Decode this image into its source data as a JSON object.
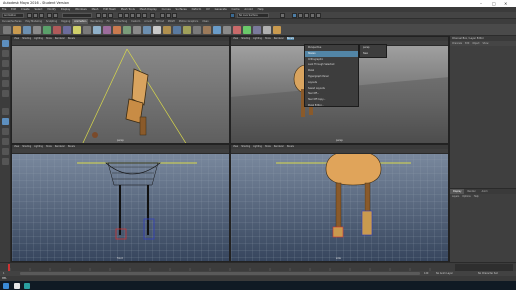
{
  "window": {
    "title": "Autodesk Maya 2016 - Student Version",
    "minimize": "–",
    "maximize": "□",
    "close": "✕"
  },
  "menubar": [
    "File",
    "Edit",
    "Create",
    "Select",
    "Modify",
    "Display",
    "Windows",
    "Mesh",
    "Edit Mesh",
    "Mesh Tools",
    "Mesh Display",
    "Curves",
    "Surfaces",
    "Deform",
    "UV",
    "Generate",
    "Cache",
    "Arnold",
    "Help"
  ],
  "statusline": {
    "menuset": "Animation",
    "no_live": "No Live Surface"
  },
  "shelf_tabs": [
    "Curves/Surfaces",
    "Poly Modeling",
    "Sculpting",
    "Rigging",
    "Animation",
    "Rendering",
    "FX",
    "FX Caching",
    "Custom",
    "Arnold",
    "Bifrost",
    "MASH",
    "Motion Graphics",
    "XGen"
  ],
  "shelf_active": "Animation",
  "viewports": {
    "panel_menu": [
      "View",
      "Shading",
      "Lighting",
      "Show",
      "Renderer",
      "Panels"
    ],
    "top_left": "persp",
    "top_right": "persp",
    "bottom_left": "front",
    "bottom_right": "side"
  },
  "panels_dropdown": {
    "items": [
      "Perspective",
      "Stereo",
      "Orthographic",
      "Look Through Selected",
      "Panel",
      "Hypergraph Panel",
      "Layouts",
      "Saved Layouts",
      "Tear Off...",
      "Tear Off Copy...",
      "Panel Editor..."
    ],
    "highlighted": "Stereo",
    "submenu": [
      "persp",
      "New"
    ]
  },
  "channel_box": {
    "header": "Channel Box / Layer Editor",
    "menus": [
      "Channels",
      "Edit",
      "Object",
      "Show"
    ]
  },
  "layer_editor": {
    "tabs": [
      "Display",
      "Render",
      "Anim"
    ],
    "active_tab": "Display",
    "menus": [
      "Layers",
      "Options",
      "Help"
    ]
  },
  "range": {
    "start": "1",
    "end": "120",
    "anim_layer": "No Anim Layer",
    "char_set": "No Character Set"
  },
  "cmdline": {
    "label": "MEL"
  },
  "colors": {
    "accent": "#5285a6",
    "viewport_top": "#9a9a9a",
    "viewport_bottom": "#3a4a63",
    "char_orange": "#e0a45a"
  }
}
